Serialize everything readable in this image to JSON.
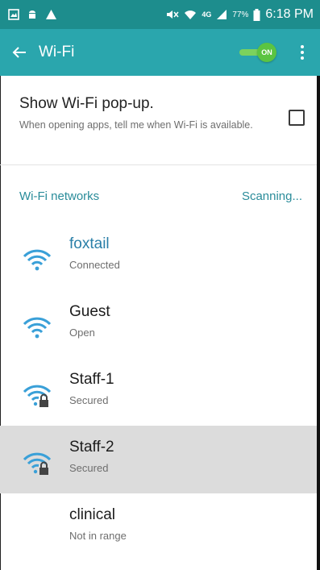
{
  "statusbar": {
    "battery_percent": "77%",
    "time": "6:18 PM",
    "network_type": "4G",
    "icons_left": [
      "gallery-icon",
      "android-icon",
      "warning-icon"
    ],
    "icons_right": [
      "mute-icon",
      "wifi-icon",
      "4g-icon",
      "signal-icon",
      "battery-icon"
    ]
  },
  "appbar": {
    "title": "Wi-Fi",
    "toggle_label": "ON",
    "toggle_color": "#5bc442",
    "background": "#2aa6ad"
  },
  "popup_setting": {
    "title": "Show Wi-Fi pop-up.",
    "description": "When opening apps, tell me when Wi-Fi is available.",
    "checked": false
  },
  "networks_section": {
    "title": "Wi-Fi networks",
    "scanning_label": "Scanning..."
  },
  "networks": [
    {
      "name": "foxtail",
      "status": "Connected",
      "icon": "wifi-icon",
      "secured": false,
      "connected": true
    },
    {
      "name": "Guest",
      "status": "Open",
      "icon": "wifi-icon",
      "secured": false,
      "connected": false
    },
    {
      "name": "Staff-1",
      "status": "Secured",
      "icon": "wifi-lock-icon",
      "secured": true,
      "connected": false
    },
    {
      "name": "Staff-2",
      "status": "Secured",
      "icon": "wifi-lock-icon",
      "secured": true,
      "connected": false,
      "selected": true
    },
    {
      "name": "clinical",
      "status": "Not in range",
      "icon": "",
      "secured": false,
      "connected": false
    }
  ],
  "colors": {
    "accent": "#2a8c9a",
    "wifi_icon": "#3aa0d8",
    "statusbar": "#1d8d8d"
  }
}
